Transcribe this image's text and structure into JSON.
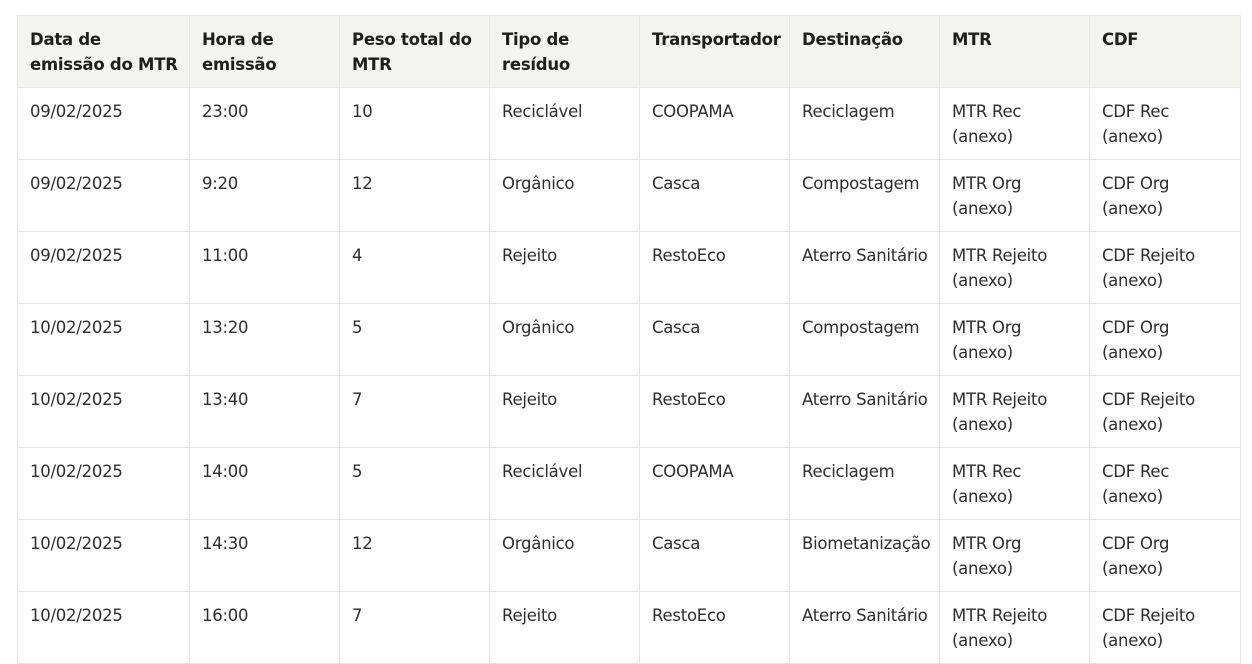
{
  "table": {
    "headers": [
      "Data de emissão do MTR",
      "Hora de emissão",
      "Peso total do MTR",
      "Tipo de resíduo",
      "Transportador",
      "Destinação",
      "MTR",
      "CDF"
    ],
    "rows": [
      [
        "09/02/2025",
        "23:00",
        "10",
        "Reciclável",
        "COOPAMA",
        "Reciclagem",
        "MTR Rec (anexo)",
        "CDF Rec (anexo)"
      ],
      [
        "09/02/2025",
        "9:20",
        "12",
        "Orgânico",
        "Casca",
        "Compostagem",
        "MTR Org (anexo)",
        "CDF Org (anexo)"
      ],
      [
        "09/02/2025",
        "11:00",
        "4",
        "Rejeito",
        "RestoEco",
        "Aterro Sanitário",
        "MTR Rejeito (anexo)",
        "CDF Rejeito (anexo)"
      ],
      [
        "10/02/2025",
        "13:20",
        "5",
        "Orgânico",
        "Casca",
        "Compostagem",
        "MTR Org (anexo)",
        "CDF Org (anexo)"
      ],
      [
        "10/02/2025",
        "13:40",
        "7",
        "Rejeito",
        "RestoEco",
        "Aterro Sanitário",
        "MTR Rejeito (anexo)",
        "CDF Rejeito (anexo)"
      ],
      [
        "10/02/2025",
        "14:00",
        "5",
        "Reciclável",
        "COOPAMA",
        "Reciclagem",
        "MTR Rec (anexo)",
        "CDF Rec (anexo)"
      ],
      [
        "10/02/2025",
        "14:30",
        "12",
        "Orgânico",
        "Casca",
        "Biometanização",
        "MTR Org (anexo)",
        "CDF Org (anexo)"
      ],
      [
        "10/02/2025",
        "16:00",
        "7",
        "Rejeito",
        "RestoEco",
        "Aterro Sanitário",
        "MTR Rejeito (anexo)",
        "CDF Rejeito (anexo)"
      ]
    ]
  }
}
